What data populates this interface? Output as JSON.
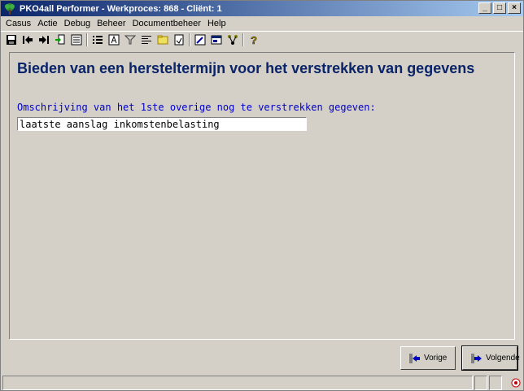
{
  "window": {
    "title": "PKO4all Performer - Werkproces: 868 - Cliënt: 1",
    "minimize": "_",
    "maximize": "□",
    "close": "×"
  },
  "menu": [
    "Casus",
    "Actie",
    "Debug",
    "Beheer",
    "Documentbeheer",
    "Help"
  ],
  "toolbar": {
    "icons": [
      "save-icon",
      "back-icon",
      "forward-icon",
      "attach-icon",
      "form-icon",
      "list-icon",
      "text-icon",
      "filter-icon",
      "align-icon",
      "folder-icon",
      "note-icon",
      "edit-icon",
      "window-icon",
      "branch-icon",
      "help-icon"
    ]
  },
  "page": {
    "title": "Bieden van een hersteltermijn voor het verstrekken van gegevens",
    "field_label": "Omschrijving van het 1ste overige nog te verstrekken gegeven:",
    "field_value": "laatste aanslag inkomstenbelasting"
  },
  "buttons": {
    "previous": "Vorige",
    "next": "Volgende"
  },
  "colors": {
    "title_blue": "#0a246a",
    "label_blue": "#0000cc",
    "face": "#d4d0c8"
  }
}
